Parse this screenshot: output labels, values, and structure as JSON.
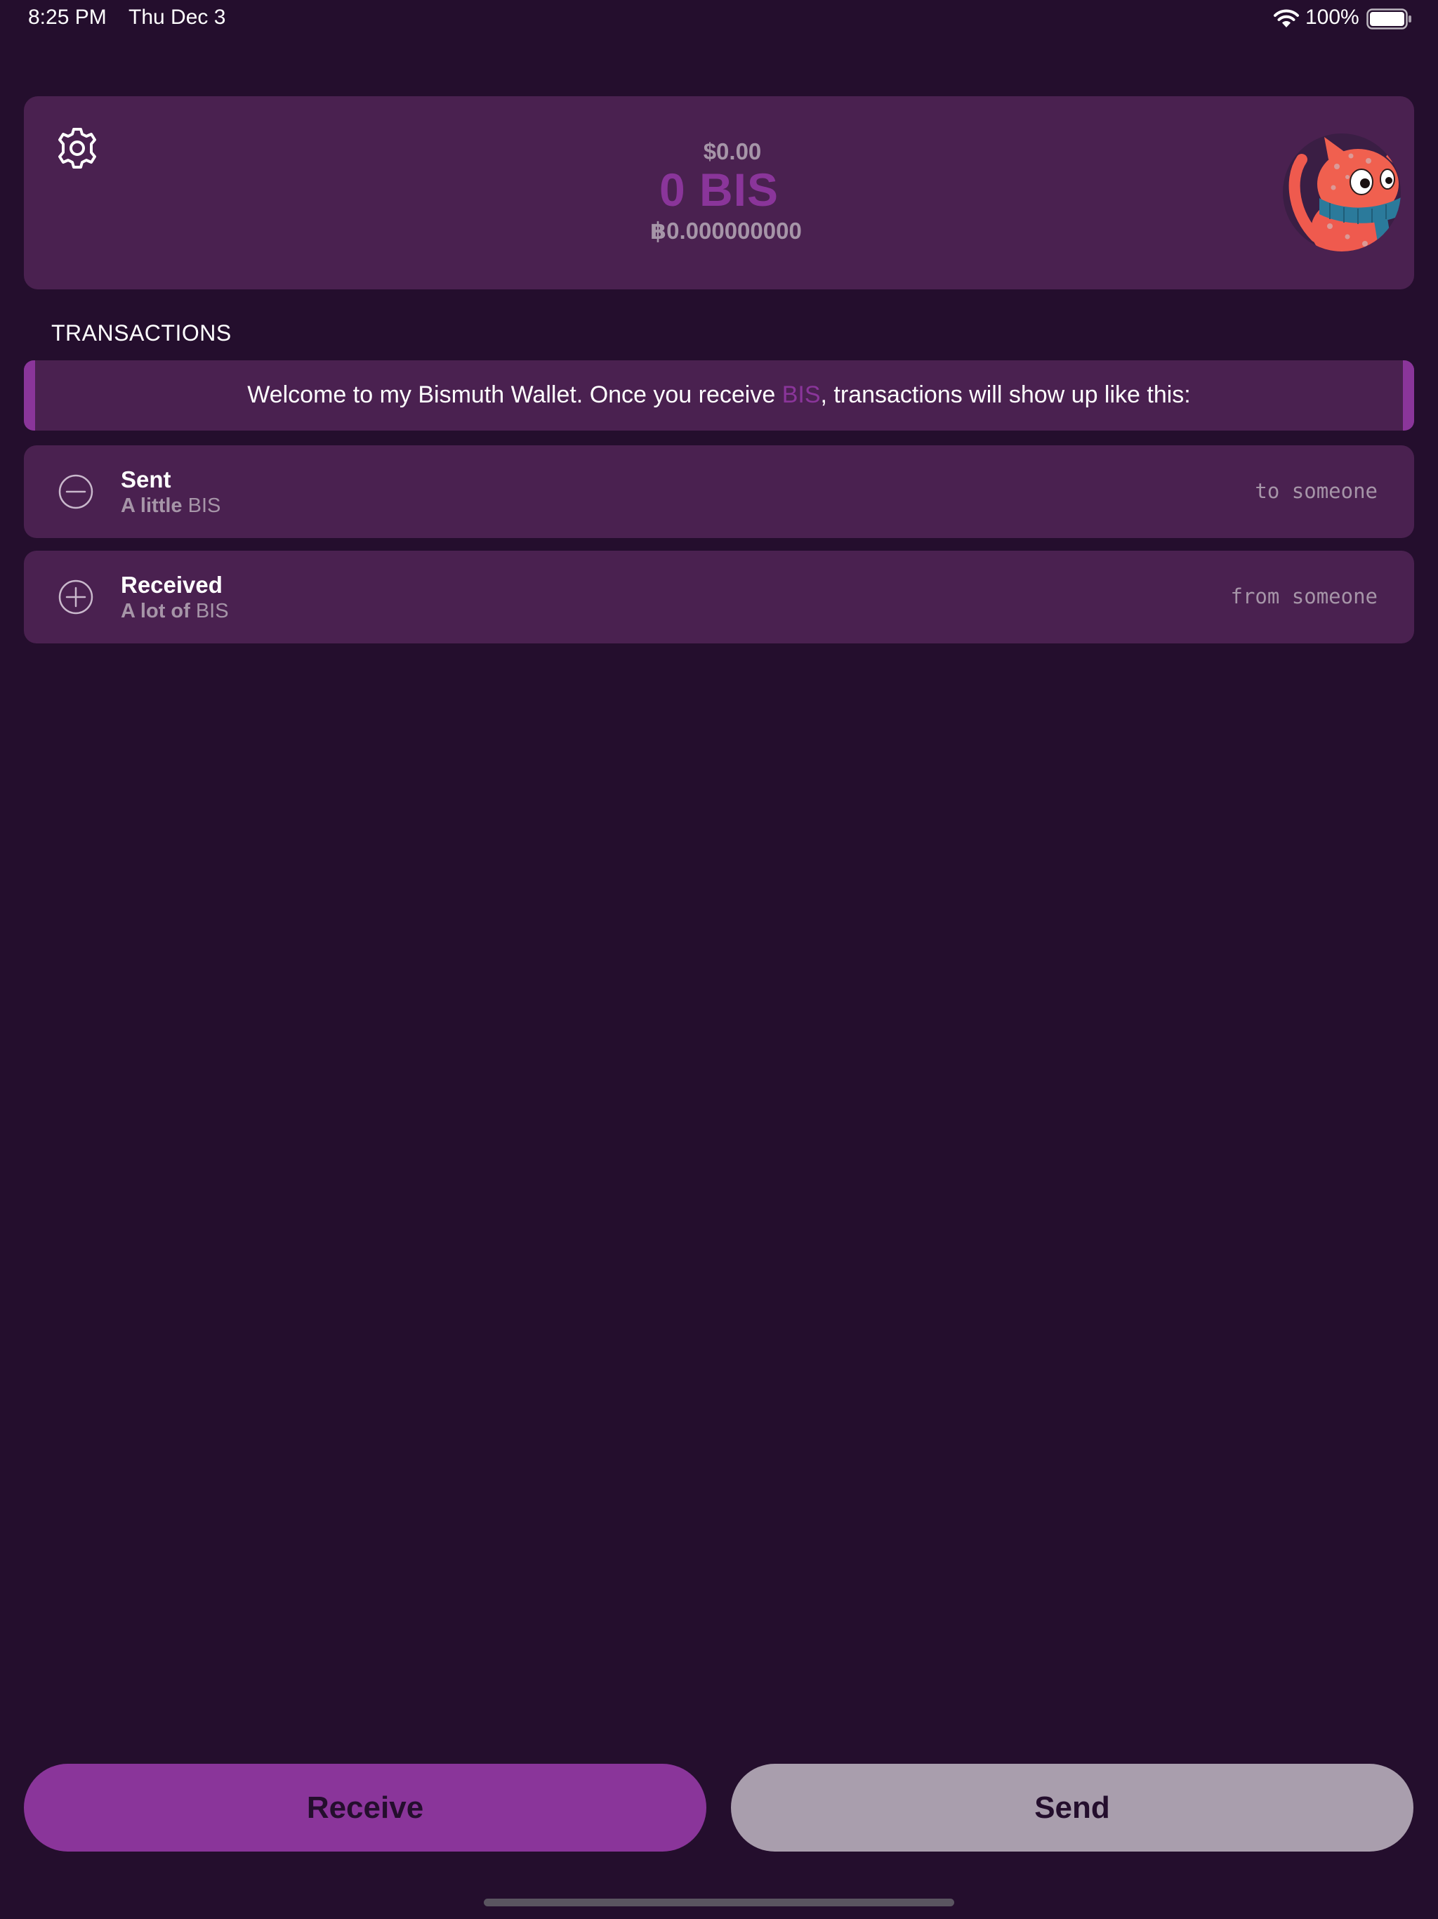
{
  "status_bar": {
    "time": "8:25 PM",
    "date": "Thu Dec 3",
    "battery": "100%"
  },
  "balance": {
    "fiat": "$0.00",
    "bis": "0 BIS",
    "btc_symbol": "฿",
    "btc": "0.000000000"
  },
  "transactions": {
    "header": "TRANSACTIONS",
    "welcome": {
      "before": "Welcome to my Bismuth Wallet. Once you receive ",
      "highlight": "BIS",
      "after": ", transactions will show up like this:"
    },
    "items": [
      {
        "title": "Sent",
        "amount": "A little",
        "unit": "BIS",
        "counterparty": "to someone",
        "icon": "minus-circle-icon"
      },
      {
        "title": "Received",
        "amount": "A lot of",
        "unit": "BIS",
        "counterparty": "from someone",
        "icon": "plus-circle-icon"
      }
    ]
  },
  "actions": {
    "receive_label": "Receive",
    "send_label": "Send"
  },
  "colors": {
    "background": "#240e2d",
    "card": "#4a2150",
    "accent": "#8a359a",
    "muted_text": "#a695a8",
    "send_button": "#a99ead"
  }
}
